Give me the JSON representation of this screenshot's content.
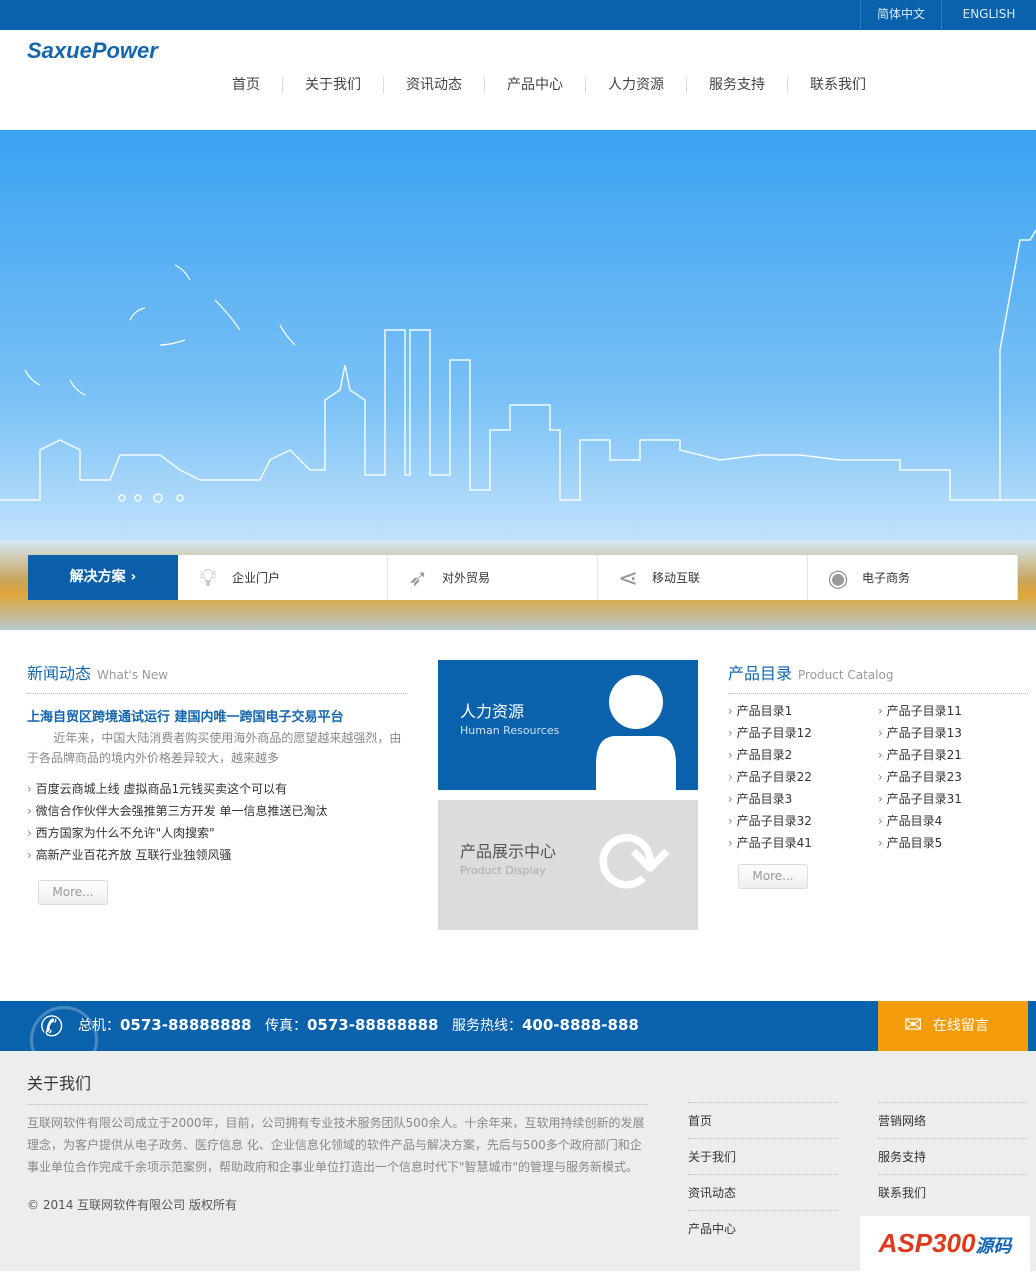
{
  "topbar": {
    "lang_cn": "简体中文",
    "lang_en": "ENGLISH"
  },
  "header": {
    "logo": "SaxuePower",
    "nav": [
      "首页",
      "关于我们",
      "资讯动态",
      "产品中心",
      "人力资源",
      "服务支持",
      "联系我们"
    ]
  },
  "solutions": {
    "button": "解决方案",
    "items": [
      {
        "label": "企业门户",
        "icon": "lightbulb-icon"
      },
      {
        "label": "对外贸易",
        "icon": "rocket-icon"
      },
      {
        "label": "移动互联",
        "icon": "share-icon"
      },
      {
        "label": "电子商务",
        "icon": "globe-icon"
      }
    ]
  },
  "news": {
    "title": "新闻动态",
    "subtitle": "What's New",
    "headline": "上海自贸区跨境通试运行 建国内唯一跨国电子交易平台",
    "summary": "近年来，中国大陆消费者购买使用海外商品的愿望越来越强烈，由于各品牌商品的境内外价格差异较大，越来越多",
    "items": [
      "百度云商城上线 虚拟商品1元钱买卖这个可以有",
      "微信合作伙伴大会强推第三方开发 单一信息推送已淘汰",
      "西方国家为什么不允许\"人肉搜索\"",
      "高新产业百花齐放 互联行业独领风骚"
    ],
    "more": "More..."
  },
  "tiles": [
    {
      "title": "人力资源",
      "subtitle": "Human Resources"
    },
    {
      "title": "产品展示中心",
      "subtitle": "Product Display"
    }
  ],
  "catalog": {
    "title": "产品目录",
    "subtitle": "Product Catalog",
    "col1": [
      "产品目录1",
      "产品子目录12",
      "产品目录2",
      "产品子目录22",
      "产品目录3",
      "产品子目录32",
      "产品子目录41"
    ],
    "col2": [
      "产品子目录11",
      "产品子目录13",
      "产品子目录21",
      "产品子目录23",
      "产品子目录31",
      "产品目录4",
      "产品目录5"
    ],
    "more": "More..."
  },
  "contact": {
    "phone_label": "总机：",
    "phone": "0573-88888888",
    "fax_label": "传真：",
    "fax": "0573-88888888",
    "hotline_label": "服务热线：",
    "hotline": "400-8888-888",
    "message_button": "在线留言"
  },
  "footer": {
    "about_title": "关于我们",
    "about_text": "互联网软件有限公司成立于2000年，目前，公司拥有专业技术服务团队500余人。十余年来，互软用持续创新的发展理念，为客户提供从电子政务、医疗信息 化、企业信息化领域的软件产品与解决方案，先后与500多个政府部门和企事业单位合作完成千余项示范案例，帮助政府和企事业单位打造出一个信息时代下\"智慧城市\"的管理与服务新模式。",
    "copyright": "© 2014 互联网软件有限公司 版权所有",
    "links1": [
      "首页",
      "关于我们",
      "资讯动态",
      "产品中心"
    ],
    "links2": [
      "营销网络",
      "服务支持",
      "联系我们"
    ],
    "watermark": "ASP300源码"
  }
}
